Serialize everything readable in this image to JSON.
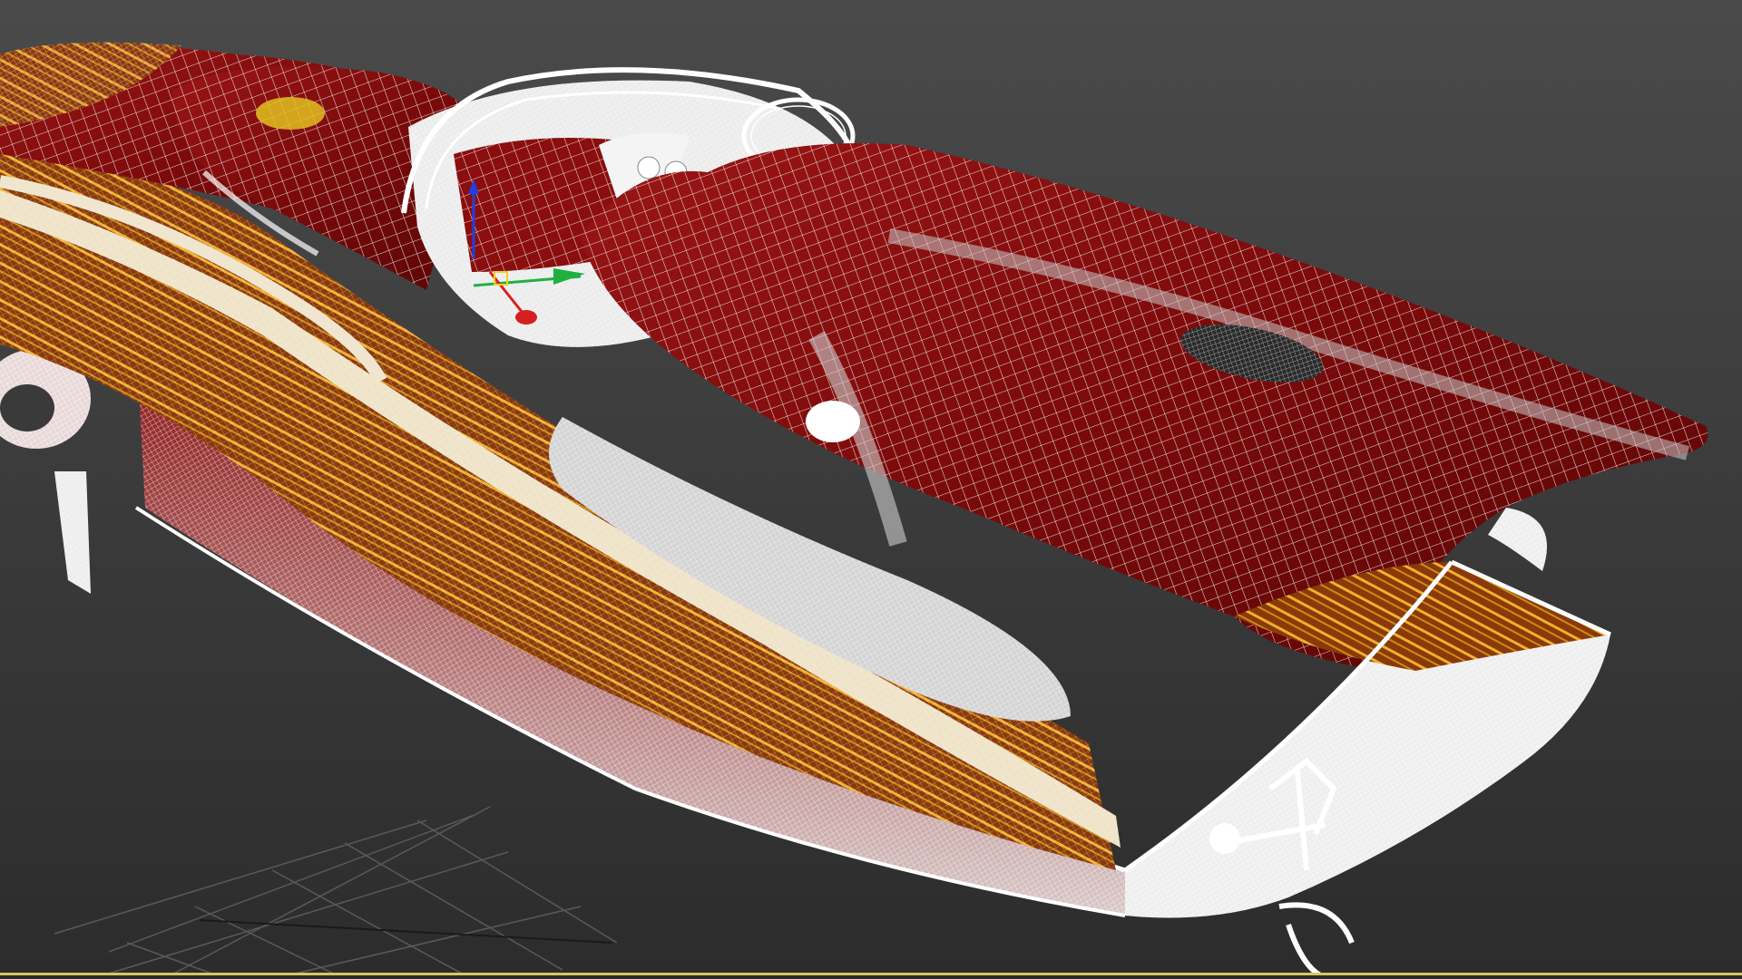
{
  "viewport": {
    "background_top": "#4a4a4a",
    "background_bottom": "#2c2c2c",
    "active_border_color": "#d6c85a"
  },
  "model": {
    "hull_color": "#7a0a0a",
    "hull_highlight": "#b82222",
    "wood_color": "#b07010",
    "cream_stripe": "#efe3c8",
    "wireframe_color": "#ffffff"
  },
  "gizmo": {
    "x_axis_color": "#d62020",
    "y_axis_color": "#20b040",
    "z_axis_color": "#2040e0",
    "pivot_color": "#f0d020"
  },
  "grid": {
    "color": "#5a5a5a"
  }
}
